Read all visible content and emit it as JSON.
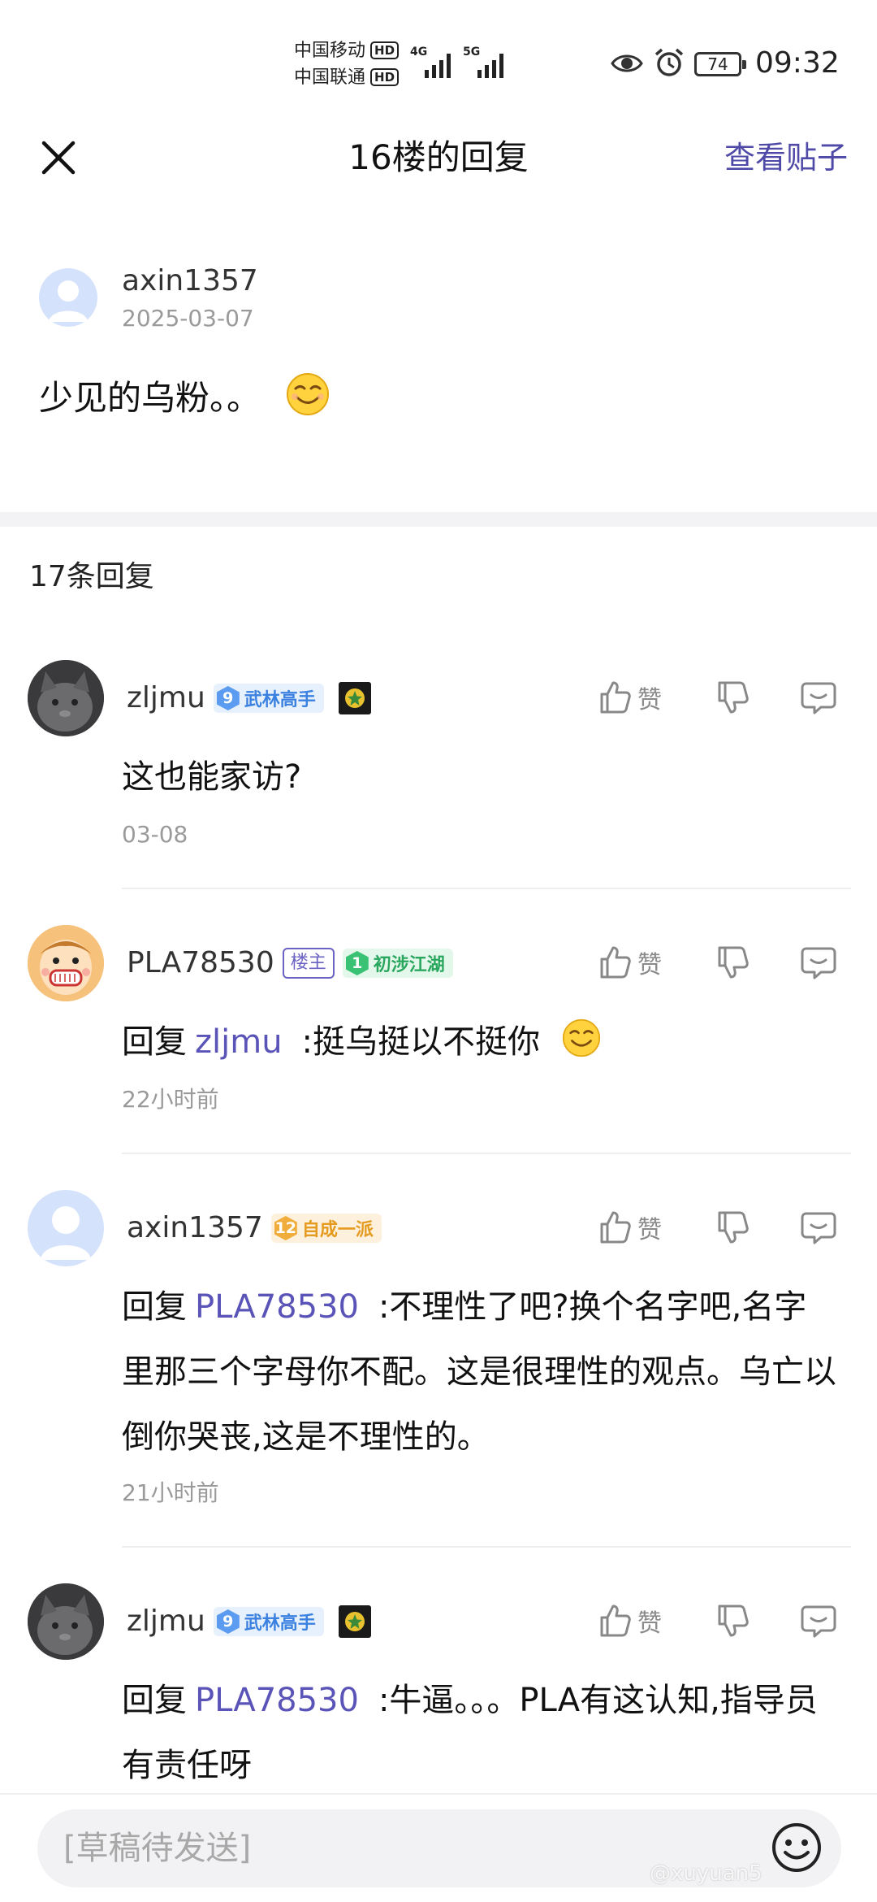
{
  "status_bar": {
    "carrier1": "中国移动",
    "carrier2": "中国联通",
    "hd": "HD",
    "net1": "4G",
    "net2": "5G",
    "battery": "74",
    "time": "09:32"
  },
  "header": {
    "title": "16楼的回复",
    "view_post": "查看贴子"
  },
  "main_post": {
    "author": "axin1357",
    "date": "2025-03-07",
    "content": "少见的乌粉。。"
  },
  "reply_count": "17条回复",
  "like_label": "赞",
  "comments": [
    {
      "author": "zljmu",
      "level": "9",
      "rank": "武林高手",
      "content": "这也能家访?",
      "time": "03-08"
    },
    {
      "author": "PLA78530",
      "owner_tag": "楼主",
      "level": "1",
      "rank": "初涉江湖",
      "reply_prefix": "回复",
      "mention": "zljmu",
      "content": ":挺乌挺以不挺你",
      "time": "22小时前"
    },
    {
      "author": "axin1357",
      "level": "12",
      "rank": "自成一派",
      "reply_prefix": "回复",
      "mention": "PLA78530",
      "content": ":不理性了吧?换个名字吧,名字里那三个字母你不配。这是很理性的观点。乌亡以倒你哭丧,这是不理性的。",
      "time": "21小时前"
    },
    {
      "author": "zljmu",
      "level": "9",
      "rank": "武林高手",
      "reply_prefix": "回复",
      "mention": "PLA78530",
      "content": ":牛逼。。。PLA有这认知,指导员有责任呀"
    }
  ],
  "input": {
    "placeholder": "[草稿待发送]"
  },
  "watermark": "@xuyuan5"
}
